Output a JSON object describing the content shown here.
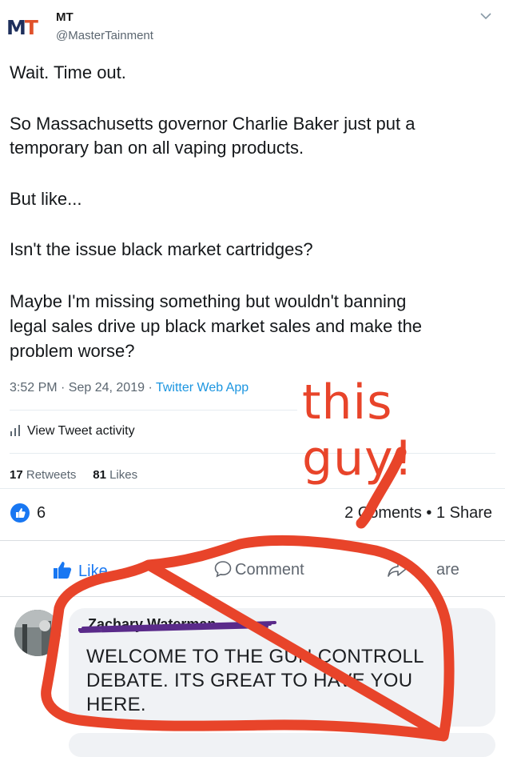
{
  "tweet": {
    "logo_m": "M",
    "logo_t": "T",
    "name": "MT",
    "handle": "@MasterTainment",
    "paragraphs": [
      "Wait. Time out.",
      "So Massachusetts governor Charlie Baker just put a",
      "temporary ban on all vaping products.",
      "But like...",
      "Isn't the issue black market cartridges?",
      "Maybe I'm missing something but wouldn't banning",
      "legal sales drive up black market sales and make the",
      "problem worse?"
    ],
    "time": "3:52 PM · Sep 24, 2019 · ",
    "app": "Twitter Web App",
    "activity": "View Tweet activity",
    "retweets_count": "17",
    "retweets_label": "Retweets",
    "likes_count": "81",
    "likes_label": "Likes"
  },
  "facebook": {
    "reaction_count": "6",
    "comments_share": "2 Co",
    "comments_share_rest": "ments • 1 Share",
    "like_label": "Like",
    "comment_label": "Comment",
    "share_label": "are",
    "comment": {
      "author": "Zachary Waterman",
      "text": "WELCOME TO THE GUN CONTROLL DEBATE. ITS GREAT TO HAVE YOU HERE."
    }
  },
  "annotation": {
    "text": "this guy!",
    "color": "#e8442a"
  },
  "colors": {
    "twitter_blue": "#1b95e0",
    "facebook_blue": "#1877f2",
    "logo_navy": "#1e2f5c",
    "logo_orange": "#e0522b"
  }
}
